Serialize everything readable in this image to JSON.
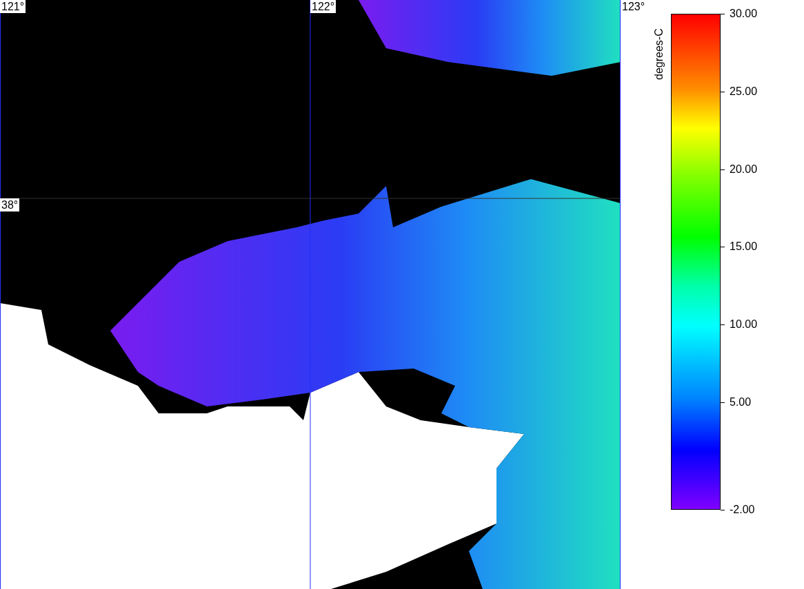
{
  "map": {
    "longitude_labels": [
      "121°",
      "122°",
      "123°"
    ],
    "latitude_labels": [
      "38°"
    ]
  },
  "legend": {
    "title": "degrees-C",
    "ticks": [
      "30.00",
      "25.00",
      "20.00",
      "15.00",
      "10.00",
      "5.00",
      "-2.00"
    ]
  }
}
